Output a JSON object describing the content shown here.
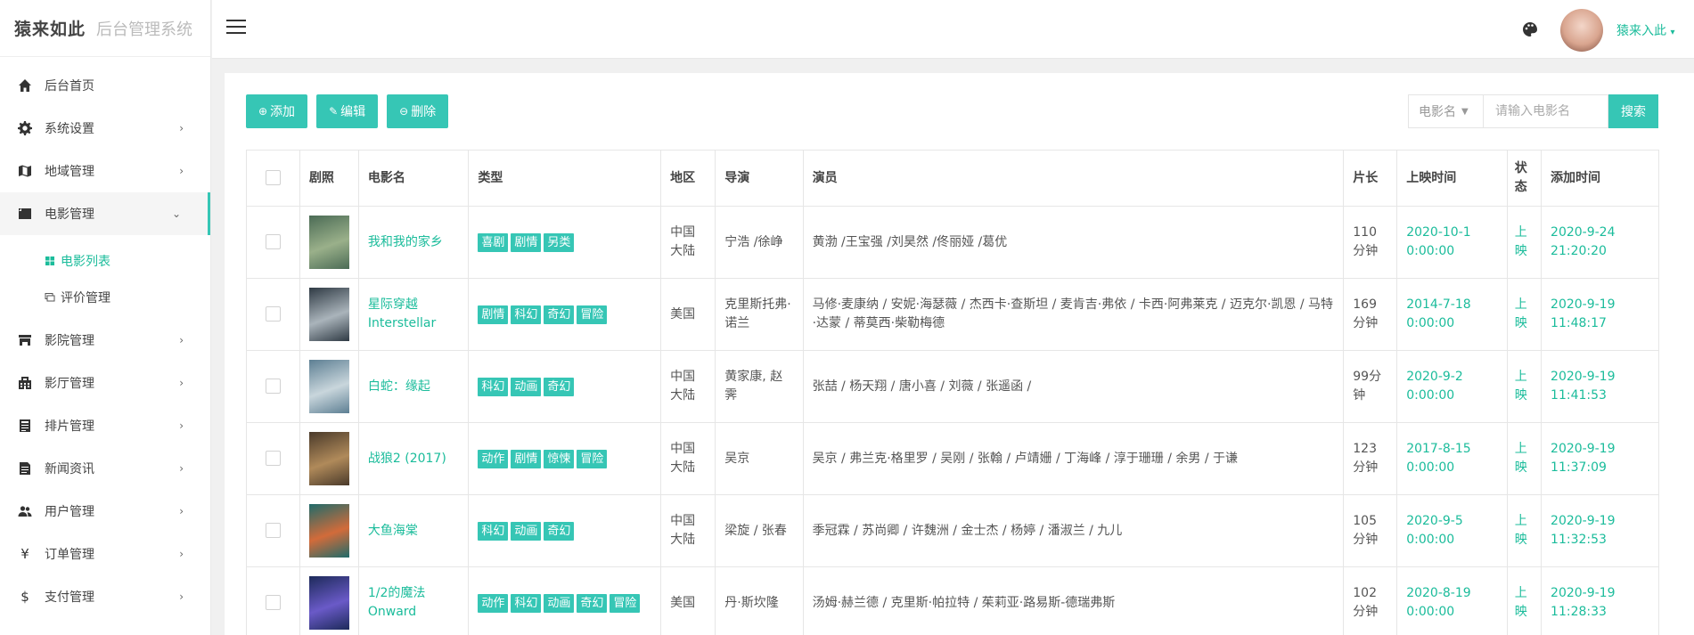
{
  "app": {
    "brand": "猿来如此",
    "subtitle": "后台管理系统"
  },
  "sidebar": {
    "items": [
      {
        "label": "后台首页",
        "icon": "home-icon"
      },
      {
        "label": "系统设置",
        "icon": "gear-icon"
      },
      {
        "label": "地域管理",
        "icon": "map-icon"
      },
      {
        "label": "电影管理",
        "icon": "film-icon"
      },
      {
        "label": "影院管理",
        "icon": "store-icon"
      },
      {
        "label": "影厅管理",
        "icon": "building-icon"
      },
      {
        "label": "排片管理",
        "icon": "calendar-icon"
      },
      {
        "label": "新闻资讯",
        "icon": "news-icon"
      },
      {
        "label": "用户管理",
        "icon": "users-icon"
      },
      {
        "label": "订单管理",
        "icon": "yen-icon"
      },
      {
        "label": "支付管理",
        "icon": "dollar-icon"
      }
    ],
    "submenu": [
      {
        "label": "电影列表",
        "icon": "grid-icon"
      },
      {
        "label": "评价管理",
        "icon": "comment-icon"
      }
    ]
  },
  "header": {
    "username": "猿来入此"
  },
  "toolbar": {
    "add_label": "添加",
    "edit_label": "编辑",
    "delete_label": "删除"
  },
  "search": {
    "field_label": "电影名",
    "placeholder": "请输入电影名",
    "button_label": "搜索"
  },
  "table": {
    "headers": [
      "剧照",
      "电影名",
      "类型",
      "地区",
      "导演",
      "演员",
      "片长",
      "上映时间",
      "状态",
      "添加时间"
    ],
    "rows": [
      {
        "title": "我和我的家乡",
        "tags": [
          "喜剧",
          "剧情",
          "另类"
        ],
        "region": "中国大陆",
        "director": "宁浩 /徐峥",
        "actors": "黄渤 /王宝强 /刘昊然 /佟丽娅 /葛优",
        "duration": "110分钟",
        "release": "2020-10-1 0:00:00",
        "status": "上映",
        "added": "2020-9-24 21:20:20",
        "poster_colors": [
          "#4b6b55",
          "#9ab08a"
        ]
      },
      {
        "title": "星际穿越 Interstellar",
        "tags": [
          "剧情",
          "科幻",
          "奇幻",
          "冒险"
        ],
        "region": "美国",
        "director": "克里斯托弗·诺兰",
        "actors": "马修·麦康纳 / 安妮·海瑟薇 / 杰西卡·查斯坦 / 麦肯吉·弗依 / 卡西·阿弗莱克 / 迈克尔·凯恩 / 马特·达蒙 / 蒂莫西·柴勒梅德",
        "duration": "169分钟",
        "release": "2014-7-18 0:00:00",
        "status": "上映",
        "added": "2020-9-19 11:48:17",
        "poster_colors": [
          "#2f3a44",
          "#aab4bb"
        ]
      },
      {
        "title": "白蛇：缘起",
        "tags": [
          "科幻",
          "动画",
          "奇幻"
        ],
        "region": "中国大陆",
        "director": "黄家康, 赵霁",
        "actors": "张喆 / 杨天翔 / 唐小喜 / 刘薇 / 张遥函 /",
        "duration": "99分钟",
        "release": "2020-9-2 0:00:00",
        "status": "上映",
        "added": "2020-9-19 11:41:53",
        "poster_colors": [
          "#5d7f93",
          "#c9d6dc"
        ]
      },
      {
        "title": "战狼2 (2017)",
        "tags": [
          "动作",
          "剧情",
          "惊悚",
          "冒险"
        ],
        "region": "中国大陆",
        "director": "吴京",
        "actors": "吴京 / 弗兰克·格里罗 / 吴刚 / 张翰 / 卢靖姗 / 丁海峰 / 淳于珊珊 / 余男 / 于谦",
        "duration": "123分钟",
        "release": "2017-8-15 0:00:00",
        "status": "上映",
        "added": "2020-9-19 11:37:09",
        "poster_colors": [
          "#4a3a2a",
          "#b08a5a"
        ]
      },
      {
        "title": "大鱼海棠",
        "tags": [
          "科幻",
          "动画",
          "奇幻"
        ],
        "region": "中国大陆",
        "director": "梁旋 / 张春",
        "actors": "季冠霖 / 苏尚卿 / 许魏洲 / 金士杰 / 杨婷 / 潘淑兰 / 九儿",
        "duration": "105分钟",
        "release": "2020-9-5 0:00:00",
        "status": "上映",
        "added": "2020-9-19 11:32:53",
        "poster_colors": [
          "#1f6b6a",
          "#d26b3a"
        ]
      },
      {
        "title": "1/2的魔法 Onward",
        "tags": [
          "动作",
          "科幻",
          "动画",
          "奇幻",
          "冒险"
        ],
        "region": "美国",
        "director": "丹·斯坎隆",
        "actors": "汤姆·赫兰德 / 克里斯·帕拉特 / 茱莉亚·路易斯-德瑞弗斯",
        "duration": "102分钟",
        "release": "2020-8-19 0:00:00",
        "status": "上映",
        "added": "2020-9-19 11:28:33",
        "poster_colors": [
          "#1d2a5a",
          "#6a5ac8"
        ]
      }
    ]
  },
  "colors": {
    "accent": "#36c6b5",
    "link": "#1bbc9b"
  }
}
